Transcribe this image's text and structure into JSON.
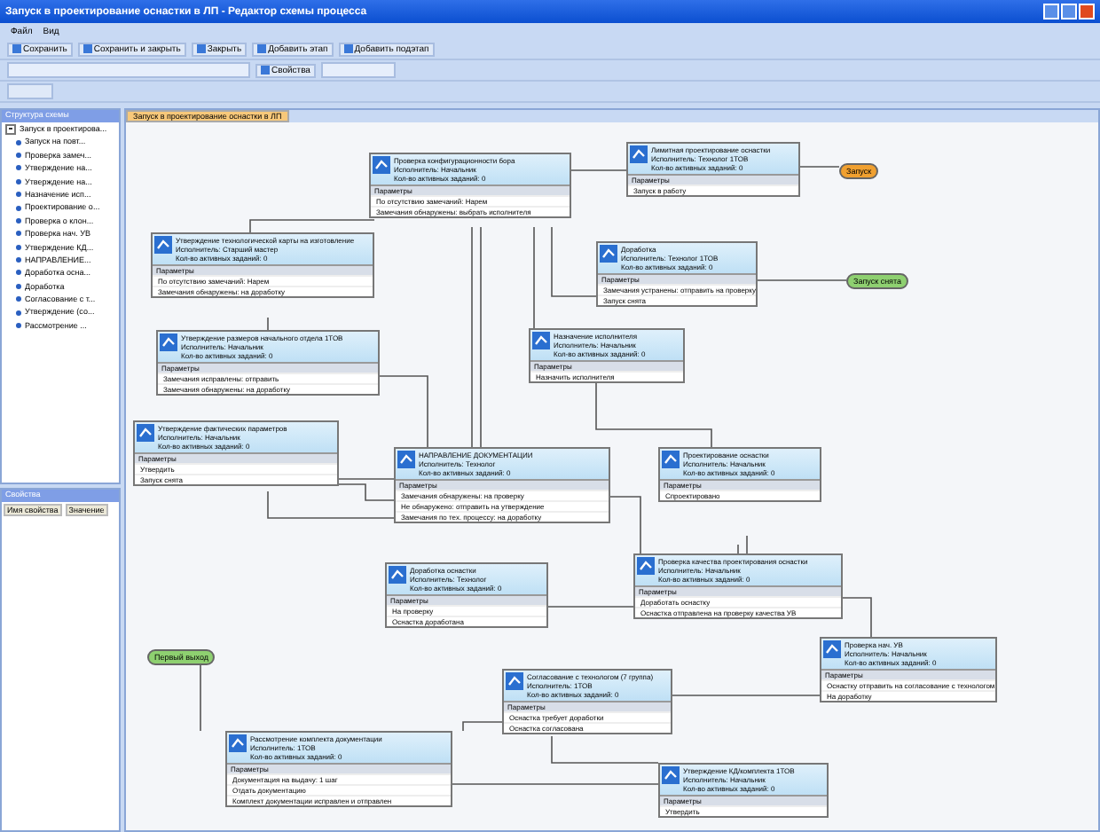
{
  "window": {
    "title": "Запуск в проектирование оснастки в ЛП - Редактор схемы процесса"
  },
  "menu": [
    "Файл",
    "Вид"
  ],
  "toolbar": [
    "Сохранить",
    "Сохранить и закрыть",
    "Закрыть",
    "Добавить этап",
    "Добавить подэтап"
  ],
  "toolbar2": [
    "Свойства"
  ],
  "structure": {
    "title": "Структура схемы",
    "root": {
      "label": "Запуск в проектирова...",
      "expanded": true,
      "children": [
        {
          "label": "Запуск на повт..."
        },
        {
          "label": "Проверка замеч..."
        },
        {
          "label": "Утверждение на..."
        },
        {
          "label": "Утверждение на..."
        },
        {
          "label": "Назначение исп..."
        },
        {
          "label": "Проектирование о..."
        },
        {
          "label": "Проверка о клон..."
        },
        {
          "label": "Проверка нач. УВ"
        },
        {
          "label": "Утверждение КД..."
        },
        {
          "label": "НАПРАВЛЕНИЕ..."
        },
        {
          "label": "Доработка осна..."
        },
        {
          "label": "Доработка"
        },
        {
          "label": "Согласование с т..."
        },
        {
          "label": "Утверждение (со..."
        },
        {
          "label": "Рассмотрение ..."
        }
      ]
    }
  },
  "properties": {
    "title": "Свойства",
    "columns": [
      "Имя свойства",
      "Значение"
    ]
  },
  "tabs": [
    {
      "label": "Запуск в проектирование оснастки в ЛП",
      "selected": true
    }
  ],
  "nodes": [
    {
      "kind": "stage",
      "title": "Проверка конфигурационности бора",
      "performer": "Исполнитель: Начальник",
      "count": "Кол-во активных заданий: 0",
      "params": "Параметры",
      "outcomes": [
        "По отсутствию замечаний: Нарем",
        "Замечания обнаружены: выбрать исполнителя"
      ]
    },
    {
      "kind": "stage",
      "title": "Лимитная проектирование оснастки",
      "performer": "Исполнитель: Технолог 1ТОВ",
      "count": "Кол-во активных заданий: 0",
      "params": "Параметры",
      "outcomes": [
        "Запуск в работу"
      ]
    },
    {
      "kind": "stage",
      "title": "Утверждение технологической карты на изготовление",
      "performer": "Исполнитель: Старший мастер",
      "count": "Кол-во активных заданий: 0",
      "params": "Параметры",
      "outcomes": [
        "По отсутствию замечаний: Нарем",
        "Замечания обнаружены: на доработку"
      ]
    },
    {
      "kind": "stage",
      "title": "Доработка",
      "performer": "Исполнитель: Технолог 1ТОВ",
      "count": "Кол-во активных заданий: 0",
      "params": "Параметры",
      "outcomes": [
        "Замечания устранены: отправить на проверку",
        "Запуск снята"
      ]
    },
    {
      "kind": "stage",
      "title": "Утверждение размеров начального отдела 1ТОВ",
      "performer": "Исполнитель: Начальник",
      "count": "Кол-во активных заданий: 0",
      "params": "Параметры",
      "outcomes": [
        "Замечания исправлены: отправить",
        "Замечания обнаружены: на доработку"
      ]
    },
    {
      "kind": "stage",
      "title": "Назначение исполнителя",
      "performer": "Исполнитель: Начальник",
      "count": "Кол-во активных заданий: 0",
      "params": "Параметры",
      "outcomes": [
        "Назначить исполнителя"
      ]
    },
    {
      "kind": "stage",
      "title": "Утверждение фактических параметров",
      "performer": "Исполнитель: Начальник",
      "count": "Кол-во активных заданий: 0",
      "params": "Параметры",
      "outcomes": [
        "Утвердить",
        "Запуск снята"
      ]
    },
    {
      "kind": "stage",
      "title": "НАПРАВЛЕНИЕ ДОКУМЕНТАЦИИ",
      "performer": "Исполнитель: Технолог",
      "count": "Кол-во активных заданий: 0",
      "params": "Параметры",
      "outcomes": [
        "Замечания обнаружены: на проверку",
        "Не обнаружено: отправить на утверждение",
        "Замечания по тех. процессу: на доработку"
      ]
    },
    {
      "kind": "stage",
      "title": "Проектирование оснастки",
      "performer": "Исполнитель: Начальник",
      "count": "Кол-во активных заданий: 0",
      "params": "Параметры",
      "outcomes": [
        "Спроектировано"
      ]
    },
    {
      "kind": "stage",
      "title": "Доработка оснастки",
      "performer": "Исполнитель: Технолог",
      "count": "Кол-во активных заданий: 0",
      "params": "Параметры",
      "outcomes": [
        "На проверку",
        "Оснастка доработана"
      ]
    },
    {
      "kind": "stage",
      "title": "Проверка качества проектирования оснастки",
      "performer": "Исполнитель: Начальник",
      "count": "Кол-во активных заданий: 0",
      "params": "Параметры",
      "outcomes": [
        "Доработать оснастку",
        "Оснастка отправлена на проверку качества УВ"
      ]
    },
    {
      "kind": "stage",
      "title": "Проверка нач. УВ",
      "performer": "Исполнитель: Начальник",
      "count": "Кол-во активных заданий: 0",
      "params": "Параметры",
      "outcomes": [
        "Оснастку отправить на согласование с технологом",
        "На доработку"
      ]
    },
    {
      "kind": "stage",
      "title": "Согласование с технологом (7 группа)",
      "performer": "Исполнитель: 1ТОВ",
      "count": "Кол-во активных заданий: 0",
      "params": "Параметры",
      "outcomes": [
        "Оснастка требует доработки",
        "Оснастка согласована"
      ]
    },
    {
      "kind": "stage",
      "title": "Рассмотрение комплекта документации",
      "performer": "Исполнитель: 1ТОВ",
      "count": "Кол-во активных заданий: 0",
      "params": "Параметры",
      "outcomes": [
        "Документация на выдачу: 1 шаг",
        "Отдать документацию",
        "Комплект документации исправлен и отправлен"
      ]
    },
    {
      "kind": "stage",
      "title": "Утверждение КД/комплекта 1ТОВ",
      "performer": "Исполнитель: Начальник",
      "count": "Кол-во активных заданий: 0",
      "params": "Параметры",
      "outcomes": [
        "Утвердить"
      ]
    },
    {
      "kind": "terminal",
      "title": "Запуск",
      "color": "#f0a030"
    },
    {
      "kind": "terminal",
      "title": "Запуск снята",
      "color": "#8ed070"
    },
    {
      "kind": "terminal",
      "title": "Первый выход",
      "color": "#8ed070"
    }
  ]
}
